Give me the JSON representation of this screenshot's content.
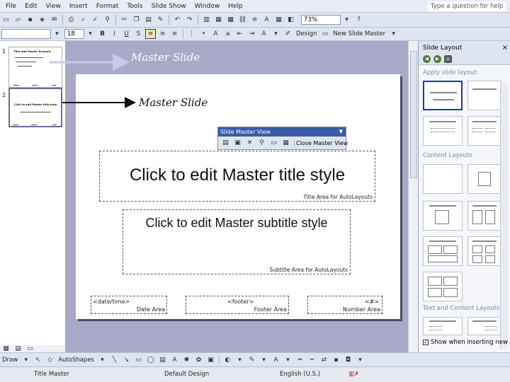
{
  "menu": {
    "items": [
      "File",
      "Edit",
      "View",
      "Insert",
      "Format",
      "Tools",
      "Slide Show",
      "Window",
      "Help"
    ],
    "help_placeholder": "Type a question for help"
  },
  "toolbar": {
    "zoom": "73%",
    "font_size": "18",
    "bold": "B",
    "italic": "I",
    "underline": "U",
    "shadow": "S",
    "design_label": "Design",
    "new_slide_master_label": "New Slide Master"
  },
  "slides": {
    "numbers": [
      "1",
      "2"
    ],
    "thumb1_title": "Title with Master Example",
    "thumb2_title": "Click to edit Master title style"
  },
  "annotations": {
    "label_1": "Master Slide",
    "label_2": "Master Slide"
  },
  "slide_master_toolbar": {
    "title": "Slide Master View",
    "close_label": "Close Master View"
  },
  "slide": {
    "title_text": "Click to edit Master title style",
    "title_area_label": "Title Area for AutoLayouts",
    "subtitle_text": "Click to edit Master subtitle style",
    "subtitle_area_label": "Subtitle Area for AutoLayouts",
    "date_placeholder": "<date/time>",
    "date_area_label": "Date Area",
    "footer_placeholder": "<footer>",
    "footer_area_label": "Footer Area",
    "number_placeholder": "<#>",
    "number_area_label": "Number Area"
  },
  "task_pane": {
    "title": "Slide Layout",
    "apply_label": "Apply slide layout:",
    "content_layouts": "Content Layouts",
    "text_content_layouts": "Text and Content Layouts",
    "show_when_inserting": "Show when inserting new slides"
  },
  "drawing_toolbar": {
    "draw_label": "Draw",
    "autoshapes_label": "AutoShapes"
  },
  "status_bar": {
    "mode": "Title Master",
    "design": "Default Design",
    "language": "English (U.S.)"
  },
  "colors": {
    "workarea": "#a9a9c7",
    "title_bar_blue": "#3a5ba8",
    "toolbar": "#dfe5f0"
  }
}
